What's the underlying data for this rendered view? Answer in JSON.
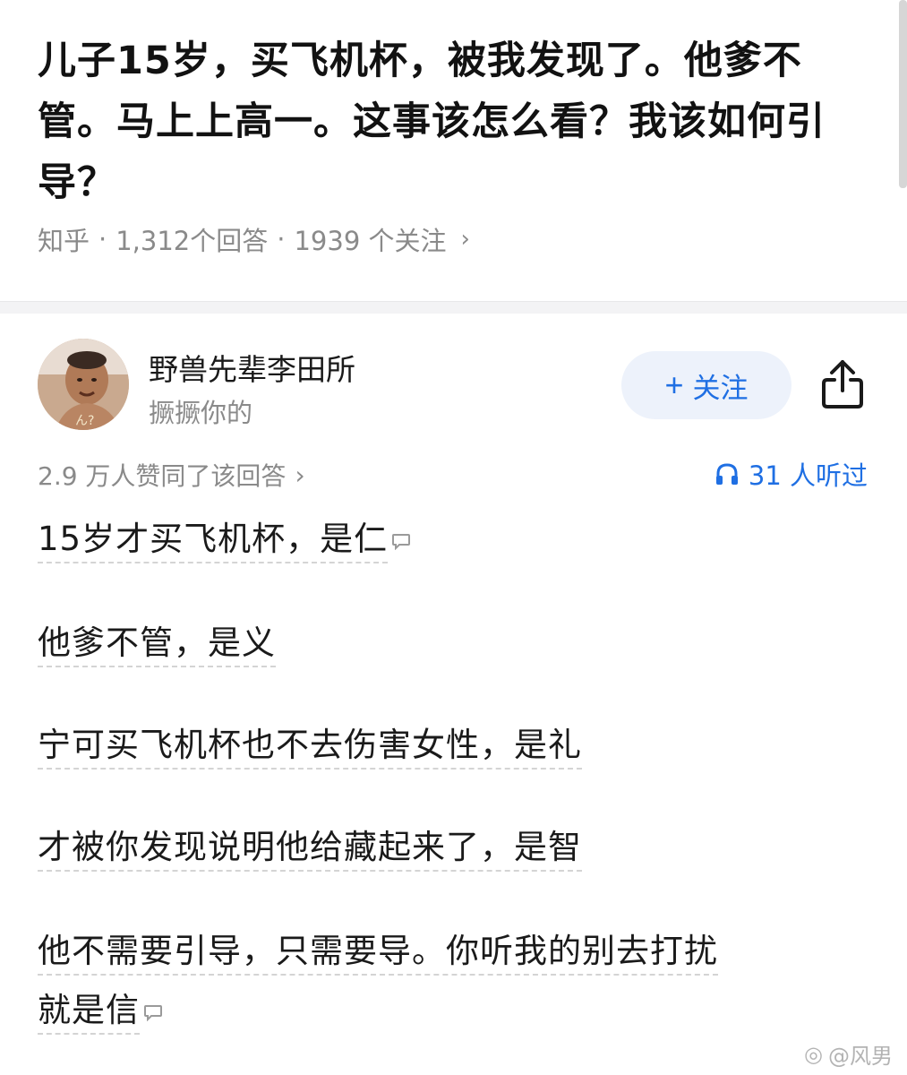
{
  "question": {
    "title": "儿子15岁，买飞机杯，被我发现了。他爹不管。马上上高一。这事该怎么看？我该如何引导？",
    "source": "知乎",
    "answers_count": "1,312个回答",
    "followers_count": "1939 个关注",
    "separator": "·"
  },
  "author": {
    "name": "野兽先辈李田所",
    "bio": "撅撅你的",
    "follow_label": "关注"
  },
  "answer_meta": {
    "approvals": "2.9 万人赞同了该回答",
    "listeners": "31 人听过"
  },
  "answer": {
    "lines": [
      "15岁才买飞机杯，是仁",
      "他爹不管，是义",
      "宁可买飞机杯也不去伤害女性，是礼",
      "才被你发现说明他给藏起来了，是智",
      "他不需要引导，只需要导。你听我的别去打扰",
      "就是信"
    ]
  },
  "watermark": "@风男",
  "colors": {
    "accent": "#1f6fe3",
    "muted": "#8a8a8a",
    "follow_bg": "#edf2fb"
  }
}
